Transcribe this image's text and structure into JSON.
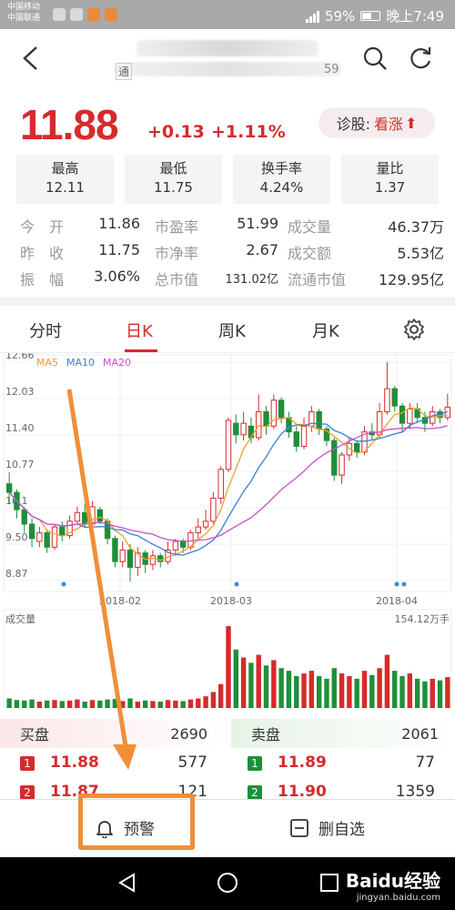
{
  "status_bar": {
    "carrier1": "中国移动",
    "carrier2": "中国联通",
    "battery": "59%",
    "time": "晚上7:49"
  },
  "header": {
    "title_blurred": "",
    "subtitle_prefix": "通",
    "subtitle_suffix": "59"
  },
  "quote": {
    "price": "11.88",
    "change": "+0.13",
    "change_pct": "+1.11%",
    "diagnose_label": "诊股:",
    "diagnose_value": "看涨"
  },
  "stat_boxes": [
    {
      "label": "最高",
      "value": "12.11"
    },
    {
      "label": "最低",
      "value": "11.75"
    },
    {
      "label": "换手率",
      "value": "4.24%"
    },
    {
      "label": "量比",
      "value": "1.37"
    }
  ],
  "stats_rows": [
    [
      {
        "label": "今　开",
        "value": "11.86"
      },
      {
        "label": "市盈率",
        "value": "51.99"
      },
      {
        "label": "成交量",
        "value": "46.37万"
      }
    ],
    [
      {
        "label": "昨　收",
        "value": "11.75"
      },
      {
        "label": "市净率",
        "value": "2.67"
      },
      {
        "label": "成交额",
        "value": "5.53亿"
      }
    ],
    [
      {
        "label": "振　幅",
        "value": "3.06%"
      },
      {
        "label": "总市值",
        "value": "131.02亿"
      },
      {
        "label": "流通市值",
        "value": "129.95亿"
      }
    ]
  ],
  "tabs": [
    "分时",
    "日K",
    "周K",
    "月K"
  ],
  "active_tab": "日K",
  "chart_data": {
    "type": "candlestick",
    "y_ticks": [
      "12.66",
      "12.03",
      "11.40",
      "10.77",
      "10.1",
      "9.50",
      "8.87"
    ],
    "ylim": [
      8.87,
      12.66
    ],
    "x_ticks": [
      "2018-02",
      "2018-03",
      "2018-04"
    ],
    "legend": [
      {
        "name": "MA5",
        "color": "#f0a030"
      },
      {
        "name": "MA10",
        "color": "#3a7fd5"
      },
      {
        "name": "MA20",
        "color": "#c84fd0"
      }
    ],
    "candles": [
      {
        "o": 10.55,
        "c": 10.4,
        "h": 10.75,
        "l": 10.2
      },
      {
        "o": 10.4,
        "c": 10.1,
        "h": 10.45,
        "l": 9.95
      },
      {
        "o": 10.1,
        "c": 9.85,
        "h": 10.15,
        "l": 9.7
      },
      {
        "o": 9.85,
        "c": 9.6,
        "h": 9.95,
        "l": 9.45
      },
      {
        "o": 9.55,
        "c": 9.7,
        "h": 9.8,
        "l": 9.45
      },
      {
        "o": 9.7,
        "c": 9.45,
        "h": 9.75,
        "l": 9.35
      },
      {
        "o": 9.45,
        "c": 9.8,
        "h": 9.85,
        "l": 9.4
      },
      {
        "o": 9.8,
        "c": 9.65,
        "h": 9.9,
        "l": 9.55
      },
      {
        "o": 9.65,
        "c": 9.9,
        "h": 10.0,
        "l": 9.6
      },
      {
        "o": 9.9,
        "c": 10.05,
        "h": 10.15,
        "l": 9.85
      },
      {
        "o": 10.05,
        "c": 9.85,
        "h": 10.2,
        "l": 9.8
      },
      {
        "o": 9.85,
        "c": 10.15,
        "h": 10.25,
        "l": 9.8
      },
      {
        "o": 10.1,
        "c": 9.9,
        "h": 10.15,
        "l": 9.85
      },
      {
        "o": 9.9,
        "c": 9.6,
        "h": 9.95,
        "l": 9.5
      },
      {
        "o": 9.6,
        "c": 9.2,
        "h": 9.65,
        "l": 9.1
      },
      {
        "o": 9.2,
        "c": 9.4,
        "h": 9.55,
        "l": 9.1
      },
      {
        "o": 9.4,
        "c": 9.1,
        "h": 9.5,
        "l": 8.85
      },
      {
        "o": 9.1,
        "c": 9.35,
        "h": 9.45,
        "l": 8.95
      },
      {
        "o": 9.35,
        "c": 9.15,
        "h": 9.4,
        "l": 9.0
      },
      {
        "o": 9.15,
        "c": 9.3,
        "h": 9.4,
        "l": 9.05
      },
      {
        "o": 9.3,
        "c": 9.2,
        "h": 9.35,
        "l": 9.1
      },
      {
        "o": 9.2,
        "c": 9.4,
        "h": 9.55,
        "l": 9.15
      },
      {
        "o": 9.4,
        "c": 9.55,
        "h": 9.6,
        "l": 9.3
      },
      {
        "o": 9.55,
        "c": 9.45,
        "h": 9.6,
        "l": 9.35
      },
      {
        "o": 9.45,
        "c": 9.7,
        "h": 9.75,
        "l": 9.4
      },
      {
        "o": 9.7,
        "c": 9.8,
        "h": 9.95,
        "l": 9.6
      },
      {
        "o": 9.8,
        "c": 9.9,
        "h": 10.1,
        "l": 9.75
      },
      {
        "o": 9.9,
        "c": 10.3,
        "h": 10.4,
        "l": 9.85
      },
      {
        "o": 10.3,
        "c": 10.8,
        "h": 10.85,
        "l": 10.2
      },
      {
        "o": 10.8,
        "c": 11.65,
        "h": 11.7,
        "l": 10.75
      },
      {
        "o": 11.6,
        "c": 11.4,
        "h": 11.75,
        "l": 11.25
      },
      {
        "o": 11.4,
        "c": 11.6,
        "h": 11.8,
        "l": 11.3
      },
      {
        "o": 11.55,
        "c": 11.35,
        "h": 11.7,
        "l": 11.25
      },
      {
        "o": 11.35,
        "c": 11.8,
        "h": 12.1,
        "l": 11.3
      },
      {
        "o": 11.8,
        "c": 11.55,
        "h": 11.9,
        "l": 11.4
      },
      {
        "o": 11.55,
        "c": 12.0,
        "h": 12.1,
        "l": 11.5
      },
      {
        "o": 12.0,
        "c": 11.7,
        "h": 12.05,
        "l": 11.6
      },
      {
        "o": 11.7,
        "c": 11.45,
        "h": 11.8,
        "l": 11.35
      },
      {
        "o": 11.45,
        "c": 11.2,
        "h": 11.55,
        "l": 11.1
      },
      {
        "o": 11.2,
        "c": 11.55,
        "h": 11.7,
        "l": 11.15
      },
      {
        "o": 11.55,
        "c": 11.8,
        "h": 11.9,
        "l": 11.45
      },
      {
        "o": 11.8,
        "c": 11.5,
        "h": 11.85,
        "l": 11.4
      },
      {
        "o": 11.5,
        "c": 11.3,
        "h": 11.55,
        "l": 11.2
      },
      {
        "o": 11.3,
        "c": 10.7,
        "h": 11.35,
        "l": 10.6
      },
      {
        "o": 10.7,
        "c": 11.05,
        "h": 11.1,
        "l": 10.55
      },
      {
        "o": 11.05,
        "c": 11.25,
        "h": 11.35,
        "l": 10.95
      },
      {
        "o": 11.25,
        "c": 11.1,
        "h": 11.3,
        "l": 11.0
      },
      {
        "o": 11.1,
        "c": 11.45,
        "h": 11.55,
        "l": 11.05
      },
      {
        "o": 11.45,
        "c": 11.4,
        "h": 11.6,
        "l": 11.3
      },
      {
        "o": 11.4,
        "c": 11.8,
        "h": 11.95,
        "l": 11.35
      },
      {
        "o": 11.8,
        "c": 12.2,
        "h": 12.66,
        "l": 11.75
      },
      {
        "o": 12.2,
        "c": 11.9,
        "h": 12.25,
        "l": 11.8
      },
      {
        "o": 11.9,
        "c": 11.6,
        "h": 11.95,
        "l": 11.45
      },
      {
        "o": 11.6,
        "c": 11.85,
        "h": 11.95,
        "l": 11.5
      },
      {
        "o": 11.85,
        "c": 11.7,
        "h": 11.95,
        "l": 11.6
      },
      {
        "o": 11.7,
        "c": 11.6,
        "h": 11.8,
        "l": 11.45
      },
      {
        "o": 11.6,
        "c": 11.8,
        "h": 11.9,
        "l": 11.55
      },
      {
        "o": 11.8,
        "c": 11.7,
        "h": 11.85,
        "l": 11.6
      },
      {
        "o": 11.7,
        "c": 11.88,
        "h": 12.11,
        "l": 11.65
      }
    ],
    "volume_label": "成交量",
    "volume_max_label": "154.12万手",
    "volume_max": 154.12,
    "volumes": [
      18,
      15,
      14,
      16,
      12,
      14,
      15,
      13,
      14,
      16,
      12,
      15,
      14,
      16,
      17,
      13,
      18,
      12,
      14,
      13,
      12,
      15,
      14,
      13,
      16,
      18,
      22,
      30,
      45,
      154,
      110,
      95,
      85,
      100,
      80,
      90,
      75,
      70,
      60,
      65,
      70,
      60,
      55,
      75,
      65,
      60,
      55,
      70,
      62,
      75,
      100,
      70,
      60,
      65,
      55,
      50,
      55,
      52,
      58
    ]
  },
  "order_book": {
    "buy_label": "买盘",
    "buy_total": "2690",
    "sell_label": "卖盘",
    "sell_total": "2061",
    "buy_rows": [
      {
        "idx": "1",
        "price": "11.88",
        "qty": "577"
      },
      {
        "idx": "2",
        "price": "11.87",
        "qty": "121"
      }
    ],
    "sell_rows": [
      {
        "idx": "1",
        "price": "11.89",
        "qty": "77"
      },
      {
        "idx": "2",
        "price": "11.90",
        "qty": "1359"
      }
    ]
  },
  "actions": {
    "alert_label": "预警",
    "remove_label": "删自选"
  },
  "watermark": {
    "brand": "Baidu经验",
    "url": "jingyan.baidu.com"
  },
  "colors": {
    "up": "#d52b2b",
    "down": "#1e8f3a",
    "accent_orange": "#f08f37"
  }
}
